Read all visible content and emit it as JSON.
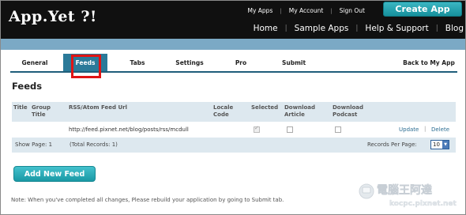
{
  "header": {
    "logo": "App.Yet ?!",
    "top_links": [
      "My Apps",
      "My Account",
      "Sign Out"
    ],
    "create_app_label": "Create App",
    "main_nav": [
      "Home",
      "Sample Apps",
      "Help & Support",
      "Blog"
    ]
  },
  "tabs": [
    {
      "label": "General"
    },
    {
      "label": "Feeds",
      "active": true
    },
    {
      "label": "Tabs"
    },
    {
      "label": "Settings"
    },
    {
      "label": "Pro"
    },
    {
      "label": "Submit"
    },
    {
      "label": "Back to My App"
    }
  ],
  "section_title": "Feeds",
  "table": {
    "columns": {
      "title": "Title",
      "group_title": "Group Title",
      "url": "RSS/Atom Feed Url",
      "locale_code": "Locale Code",
      "selected": "Selected",
      "download_article": "Download Article",
      "download_podcast": "Download Podcast"
    },
    "rows": [
      {
        "title": "",
        "group_title": "",
        "url": "http://feed.pixnet.net/blog/posts/rss/mcdull",
        "locale_code": "",
        "selected": true,
        "download_article": false,
        "download_podcast": false,
        "update_label": "Update",
        "delete_label": "Delete"
      }
    ],
    "footer": {
      "show_page": "Show Page:  1",
      "total_records": "(Total Records: 1)",
      "records_per_page_label": "Records Per Page:",
      "records_per_page_value": "10"
    }
  },
  "add_new_feed_label": "Add New Feed",
  "note": "Note: When you've completed all changes, Please rebuild your application by going to Submit tab.",
  "watermark": {
    "line1": "電腦王阿達",
    "line2": "kocpc.pixnet.net"
  },
  "colors": {
    "header_bg": "#101010",
    "accent_teal": "#1a99a5",
    "blue_strip": "#7ba9c5",
    "active_tab": "#2b7a99",
    "table_header_bg": "#dde8ef",
    "highlight_red": "#e01414",
    "link": "#2b6d92"
  }
}
